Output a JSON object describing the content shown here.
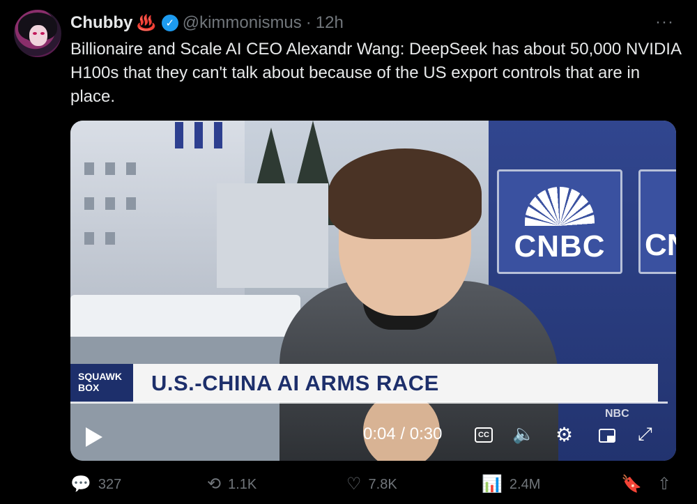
{
  "tweet": {
    "author_name": "Chubby",
    "author_emoji": "♨️",
    "verified_mark": "✓",
    "handle": "@kimmonismus",
    "separator": "·",
    "time": "12h",
    "more_label": "···",
    "text": "Billionaire and Scale AI CEO Alexandr Wang: DeepSeek has about 50,000 NVIDIA H100s that they can't talk about because of the US export controls that are in place."
  },
  "video": {
    "show_label": "SQUAWK BOX",
    "headline": "U.S.-CHINA AI ARMS RACE",
    "brand": "CNBC",
    "brand_partial": "CN",
    "bug": "NBC",
    "current_time": "0:04",
    "duration": "0:30",
    "timecode": "0:04 / 0:30",
    "cc_label": "CC",
    "controls": [
      "play-icon",
      "captions-icon",
      "volume-icon",
      "settings-icon",
      "pip-icon",
      "fullscreen-icon"
    ]
  },
  "actions": {
    "replies": "327",
    "reposts": "1.1K",
    "likes": "7.8K",
    "views": "2.4M"
  },
  "colors": {
    "background": "#000000",
    "text_primary": "#e7e9ea",
    "text_secondary": "#71767b",
    "verified": "#1d9bf0",
    "cnbc_blue": "#1d2f6b"
  }
}
